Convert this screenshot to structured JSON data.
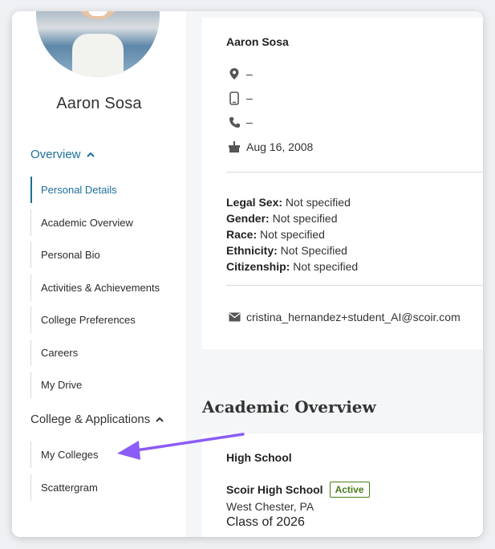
{
  "profile": {
    "name": "Aaron Sosa"
  },
  "sidebar": {
    "overview_title": "Overview",
    "overview_items": [
      {
        "label": "Personal Details",
        "active": true
      },
      {
        "label": "Academic Overview",
        "active": false
      },
      {
        "label": "Personal Bio",
        "active": false
      },
      {
        "label": "Activities & Achievements",
        "active": false
      },
      {
        "label": "College Preferences",
        "active": false
      },
      {
        "label": "Careers",
        "active": false
      },
      {
        "label": "My Drive",
        "active": false
      }
    ],
    "colleges_title": "College & Applications",
    "colleges_items": [
      {
        "label": "My Colleges",
        "active": false
      },
      {
        "label": "Scattergram",
        "active": false
      }
    ]
  },
  "details": {
    "name": "Aaron Sosa",
    "location": "–",
    "mobile": "–",
    "phone": "–",
    "birthday": "Aug 16, 2008",
    "legal_sex_label": "Legal Sex:",
    "legal_sex": "Not specified",
    "gender_label": "Gender:",
    "gender": "Not specified",
    "race_label": "Race:",
    "race": "Not specified",
    "ethnicity_label": "Ethnicity:",
    "ethnicity": "Not Specified",
    "citizenship_label": "Citizenship:",
    "citizenship": "Not specified",
    "email": "cristina_hernandez+student_AI@scoir.com"
  },
  "academic": {
    "heading": "Academic Overview",
    "hs_label": "High School",
    "school_name": "Scoir High School",
    "status": "Active",
    "location": "West Chester, PA",
    "class_of": "Class of 2026"
  },
  "colors": {
    "accent": "#1b6f9a",
    "annotation_arrow": "#8b5cf6",
    "active_badge": "#4a7a1a"
  },
  "icons": [
    "location-pin-icon",
    "mobile-phone-icon",
    "phone-icon",
    "birthday-cake-icon",
    "email-icon",
    "chevron-up-icon"
  ]
}
